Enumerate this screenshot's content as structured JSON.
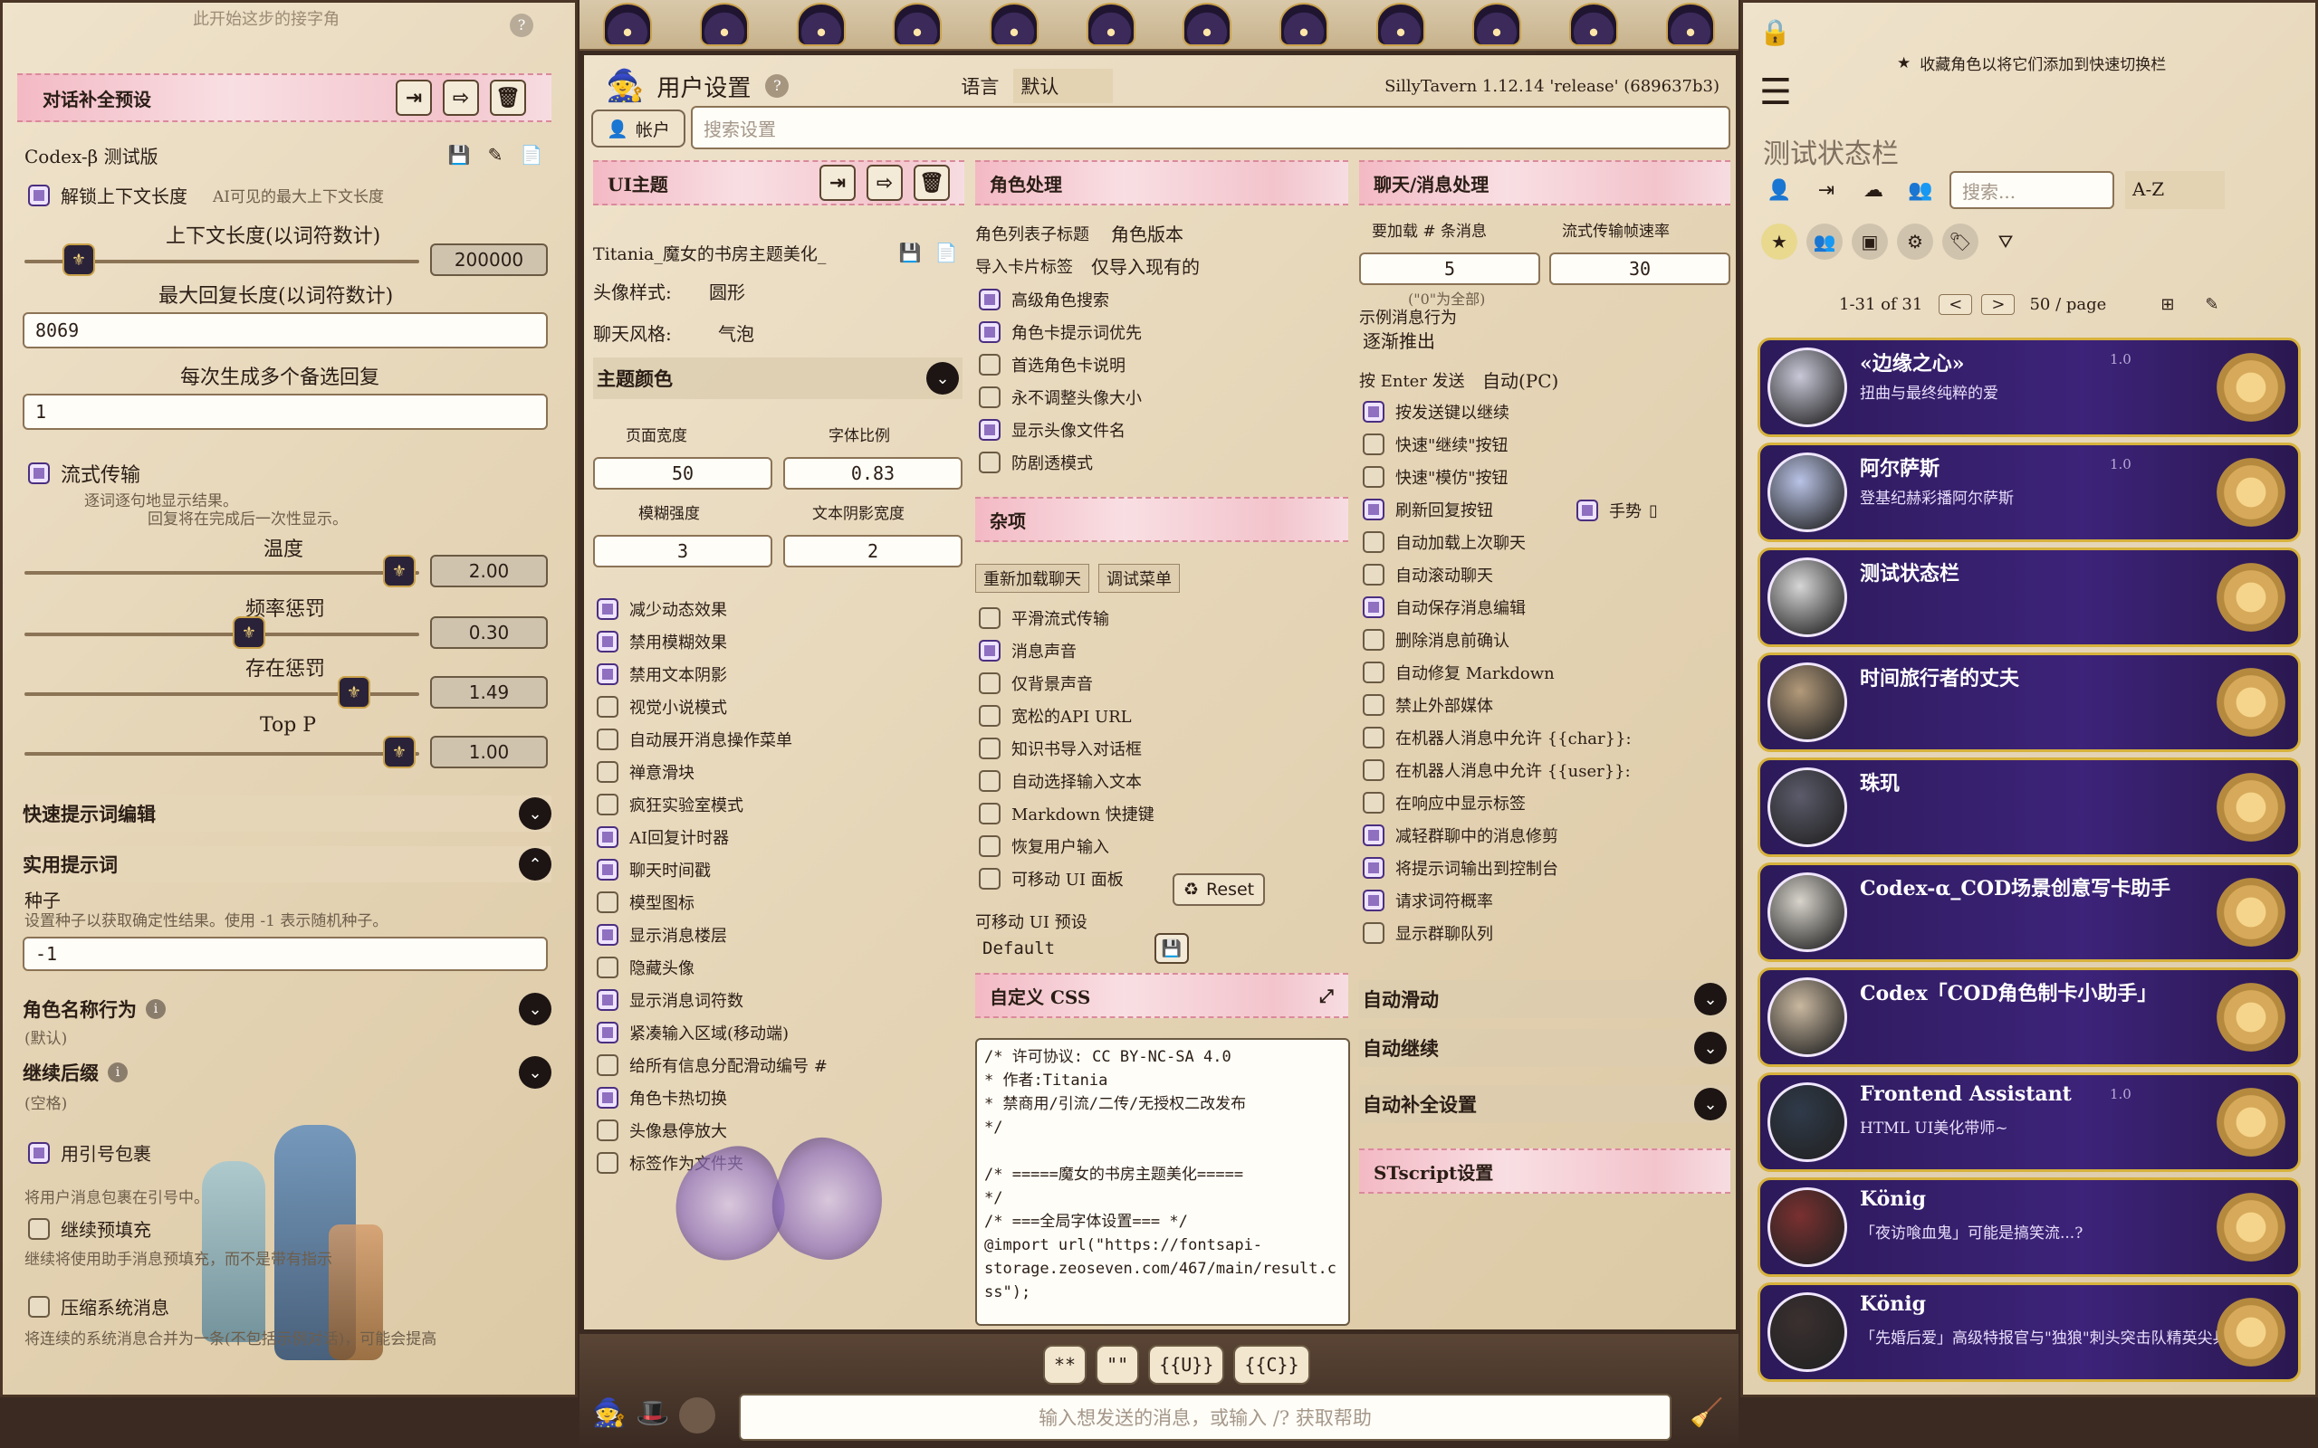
{
  "left": {
    "top_text": "此开始这步的接字角",
    "preset_section": "对话补全预设",
    "preset_name": "Codex-β 测试版",
    "unlock_ctx": "解锁上下文长度",
    "unlock_hint": "AI可见的最大上下文长度",
    "ctx_label": "上下文长度(以词符数计)",
    "ctx_value": "200000",
    "maxresp_label": "最大回复长度(以词符数计)",
    "maxresp_value": "8069",
    "swipes_label": "每次生成多个备选回复",
    "swipes_value": "1",
    "stream_label": "流式传输",
    "stream_hint1": "逐词逐句地显示结果。",
    "stream_hint2": "回复将在完成后一次性显示。",
    "temp_label": "温度",
    "temp_value": "2.00",
    "freq_label": "频率惩罚",
    "freq_value": "0.30",
    "pres_label": "存在惩罚",
    "pres_value": "1.49",
    "topp_label": "Top P",
    "topp_value": "1.00",
    "quick_prompts": "快速提示词编辑",
    "util_prompts": "实用提示词",
    "seed_label": "种子",
    "seed_hint": "设置种子以获取确定性结果。使用 -1 表示随机种子。",
    "seed_value": "-1",
    "charname_label": "角色名称行为",
    "charname_default": "(默认)",
    "cont_suffix": "继续后缀",
    "cont_empty": "(空格)",
    "cb_wrap": "用引号包裹",
    "cb_wrap_hint": "将用户消息包裹在引号中。",
    "cb_prefill": "继续预填充",
    "cb_prefill_hint": "继续将使用助手消息预填充，而不是带有指示",
    "cb_squash": "压缩系统消息",
    "cb_squash_hint": "将连续的系统消息合并为一条(不包括示例对话)，可能会提高"
  },
  "top_icons": [
    "witch-hat-1-icon",
    "witch-hat-2-icon",
    "witch-hat-3-icon",
    "witch-hat-4-icon",
    "witch-hat-5-icon",
    "witch-hat-6-icon",
    "witch-hat-7-icon",
    "witch-hat-8-icon",
    "witch-hat-9-icon",
    "witch-hat-10-icon",
    "witch-hat-11-icon",
    "witch-hat-12-icon"
  ],
  "settings": {
    "title": "用户设置",
    "lang_label": "语言",
    "lang_value": "默认",
    "version": "SillyTavern 1.12.14 'release' (689637b3)",
    "account": "帐户",
    "search_placeholder": "搜索设置",
    "ui_theme": "UI主题",
    "theme_name": "Titania_魔女的书房主题美化_",
    "avatar_style_label": "头像样式:",
    "avatar_style_value": "圆形",
    "chat_style_label": "聊天风格:",
    "chat_style_value": "气泡",
    "theme_colors": "主题颜色",
    "page_width_label": "页面宽度",
    "page_width_value": "50",
    "font_scale_label": "字体比例",
    "font_scale_value": "0.83",
    "blur_label": "模糊强度",
    "blur_value": "3",
    "shadow_label": "文本阴影宽度",
    "shadow_value": "2",
    "theme_checks": [
      {
        "label": "减少动态效果",
        "on": true
      },
      {
        "label": "禁用模糊效果",
        "on": true
      },
      {
        "label": "禁用文本阴影",
        "on": true
      },
      {
        "label": "视觉小说模式",
        "on": false
      },
      {
        "label": "自动展开消息操作菜单",
        "on": false
      },
      {
        "label": "禅意滑块",
        "on": false
      },
      {
        "label": "疯狂实验室模式",
        "on": false
      },
      {
        "label": "AI回复计时器",
        "on": true
      },
      {
        "label": "聊天时间戳",
        "on": true
      },
      {
        "label": "模型图标",
        "on": false
      },
      {
        "label": "显示消息楼层",
        "on": true
      },
      {
        "label": "隐藏头像",
        "on": false
      },
      {
        "label": "显示消息词符数",
        "on": true
      },
      {
        "label": "紧凑输入区域(移动端)",
        "on": true
      },
      {
        "label": "给所有信息分配滑动编号 #",
        "on": false
      },
      {
        "label": "角色卡热切换",
        "on": true
      },
      {
        "label": "头像悬停放大",
        "on": false
      },
      {
        "label": "标签作为文件夹",
        "on": false
      }
    ],
    "char_handling": "角色处理",
    "char_list_label": "角色列表子标题",
    "char_list_value": "角色版本",
    "import_tags_label": "导入卡片标签",
    "import_tags_value": "仅导入现有的",
    "char_checks": [
      {
        "label": "高级角色搜索",
        "on": true
      },
      {
        "label": "角色卡提示词优先",
        "on": true
      },
      {
        "label": "首选角色卡说明",
        "on": false
      },
      {
        "label": "永不调整头像大小",
        "on": false
      },
      {
        "label": "显示头像文件名",
        "on": true
      },
      {
        "label": "防剧透模式",
        "on": false
      }
    ],
    "misc": "杂项",
    "reload_chat": "重新加载聊天",
    "debug_menu": "调试菜单",
    "misc_checks": [
      {
        "label": "平滑流式传输",
        "on": false
      },
      {
        "label": "消息声音",
        "on": true
      },
      {
        "label": "仅背景声音",
        "on": false
      },
      {
        "label": "宽松的API URL",
        "on": false
      },
      {
        "label": "知识书导入对话框",
        "on": false
      },
      {
        "label": "自动选择输入文本",
        "on": false
      },
      {
        "label": "Markdown 快捷键",
        "on": false
      },
      {
        "label": "恢复用户输入",
        "on": false
      },
      {
        "label": "可移动 UI 面板",
        "on": false
      }
    ],
    "reset": "Reset",
    "movable_preset_label": "可移动 UI 预设",
    "movable_preset_value": "Default",
    "custom_css": "自定义 CSS",
    "css_lines": [
      "/* 许可协议: CC BY-NC-SA 4.0",
      "* 作者:Titania",
      "* 禁商用/引流/二传/无授权二改发布",
      "*/",
      "",
      "/* =====魔女的书房主题美化=====",
      "*/",
      "/* ===全局字体设置=== */",
      "@import url(\"https://fontsapi-",
      "storage.zeoseven.com/467/main/result.c",
      "ss\");"
    ],
    "chat_handling": "聊天/消息处理",
    "lazy_load_label": "要加载 # 条消息",
    "lazy_load_value": "5",
    "lazy_hint": "(\"0\"为全部)",
    "stream_fps_label": "流式传输帧速率",
    "stream_fps_value": "30",
    "example_msgs_label": "示例消息行为",
    "example_msgs_value": "逐渐推出",
    "enter_send_label": "按 Enter 发送",
    "enter_send_value": "自动(PC)",
    "chat_checks": [
      {
        "label": "按发送键以继续",
        "on": true
      },
      {
        "label": "快速\"继续\"按钮",
        "on": false
      },
      {
        "label": "快速\"模仿\"按钮",
        "on": false
      },
      {
        "label": "刷新回复按钮",
        "on": true
      },
      {
        "label": "自动加载上次聊天",
        "on": false
      },
      {
        "label": "自动滚动聊天",
        "on": false
      },
      {
        "label": "自动保存消息编辑",
        "on": true
      },
      {
        "label": "删除消息前确认",
        "on": false
      },
      {
        "label": "自动修复 Markdown",
        "on": false
      },
      {
        "label": "禁止外部媒体",
        "on": false
      },
      {
        "label": "在机器人消息中允许 {{char}}:",
        "on": false
      },
      {
        "label": "在机器人消息中允许 {{user}}:",
        "on": false
      },
      {
        "label": "在响应中显示标签",
        "on": false
      },
      {
        "label": "减轻群聊中的消息修剪",
        "on": true
      },
      {
        "label": "将提示词输出到控制台",
        "on": true
      },
      {
        "label": "请求词符概率",
        "on": true
      },
      {
        "label": "显示群聊队列",
        "on": false
      }
    ],
    "gesture": "手势",
    "auto_swipe": "自动滑动",
    "auto_continue": "自动继续",
    "autocomplete": "自动补全设置",
    "stscript": "STscript设置"
  },
  "right": {
    "hint": "收藏角色以将它们添加到快速切换栏",
    "title": "测试状态栏",
    "search_placeholder": "搜索...",
    "sort": "A-Z",
    "pager": "1-31 of 31",
    "per_page": "50 / page",
    "chars": [
      {
        "name": "«边缘之心»",
        "desc": "扭曲与最终纯粹的爱",
        "ver": "1.0",
        "color": "#c8c8d8"
      },
      {
        "name": "阿尔萨斯",
        "desc": "登基纪赫彩播阿尔萨斯",
        "ver": "1.0",
        "color": "#b9c3e6"
      },
      {
        "name": "测试状态栏",
        "desc": "",
        "ver": "",
        "color": "#d6d6d6"
      },
      {
        "name": "时间旅行者的丈夫",
        "desc": "",
        "ver": "",
        "color": "#b39a7a"
      },
      {
        "name": "珠玑",
        "desc": "",
        "ver": "",
        "color": "#5b5b6b"
      },
      {
        "name": "Codex-α_COD场景创意写卡助手",
        "desc": "",
        "ver": "",
        "color": "#d8d4cc"
      },
      {
        "name": "Codex「COD角色制卡小助手」",
        "desc": "",
        "ver": "",
        "color": "#c9b8a0"
      },
      {
        "name": "Frontend Assistant",
        "desc": "HTML UI美化带师~",
        "ver": "1.0",
        "color": "#2f3a4a"
      },
      {
        "name": "König",
        "desc": "「夜访喰血鬼」可能是搞笑流...?",
        "ver": "",
        "color": "#7a3030"
      },
      {
        "name": "König",
        "desc": "「先婚后爱」高级特报官与\"独狼\"刺头突击队精英尖兵",
        "ver": "",
        "color": "#3b3030"
      }
    ]
  },
  "bottom": {
    "btns": [
      "**",
      "\"\"",
      "{{U}}",
      "{{C}}"
    ],
    "input_placeholder": "输入想发送的消息，或输入 /? 获取帮助"
  }
}
